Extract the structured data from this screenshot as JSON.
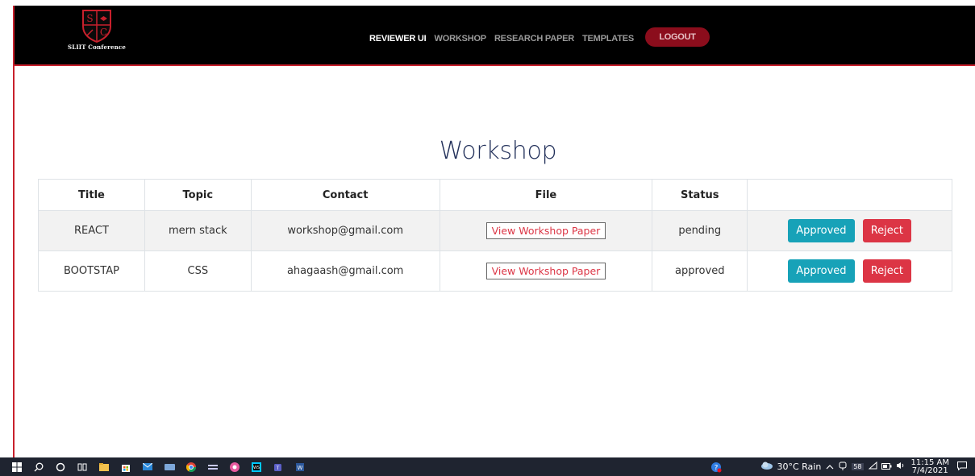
{
  "navbar": {
    "logo_text": "SLIIT Conference",
    "links": [
      {
        "label": "REVIEWER UI",
        "active": true
      },
      {
        "label": "WORKSHOP",
        "active": false
      },
      {
        "label": "RESEARCH PAPER",
        "active": false
      },
      {
        "label": "TEMPLATES",
        "active": false
      }
    ],
    "logout_label": "LOGOUT"
  },
  "page": {
    "title": "Workshop"
  },
  "table": {
    "headers": [
      "Title",
      "Topic",
      "Contact",
      "File",
      "Status",
      ""
    ],
    "rows": [
      {
        "title": "REACT",
        "topic": "mern stack",
        "contact": "workshop@gmail.com",
        "file_label": "View Workshop Paper",
        "status": "pending",
        "approve_label": "Approved",
        "reject_label": "Reject"
      },
      {
        "title": "BOOTSTAP",
        "topic": "CSS",
        "contact": "ahagaash@gmail.com",
        "file_label": "View Workshop Paper",
        "status": "approved",
        "approve_label": "Approved",
        "reject_label": "Reject"
      }
    ]
  },
  "taskbar": {
    "weather": "30°C Rain",
    "tray_badge": "58",
    "time": "11:15 AM",
    "date": "7/4/2021"
  },
  "colors": {
    "navbar_bg": "#000000",
    "accent_red": "#c8202c",
    "logout_bg": "#8b0d1c",
    "approve": "#17a2b8",
    "reject": "#dc3545",
    "title": "#22305a"
  }
}
